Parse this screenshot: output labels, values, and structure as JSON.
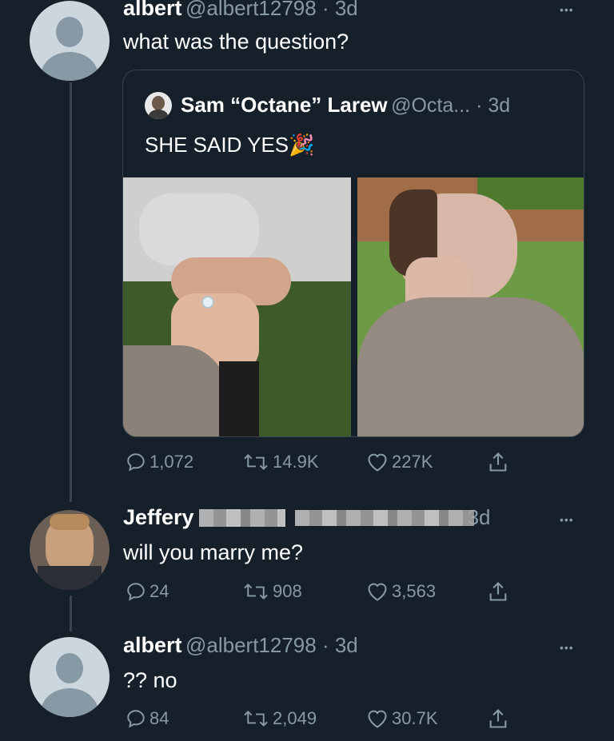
{
  "tweet1": {
    "name": "albert",
    "handle_time": "@albert12798 · 3d",
    "text": "what was the question?",
    "more": "•••",
    "quote": {
      "name": "Sam “Octane” Larew",
      "handle_time": "@Octa... · 3d",
      "text": "SHE SAID YES",
      "emoji": "🎉"
    },
    "actions": {
      "replies": "1,072",
      "retweets": "14.9K",
      "likes": "227K"
    }
  },
  "tweet2": {
    "name": "Jeffery",
    "time": "3d",
    "text": "will you marry me?",
    "more": "•••",
    "actions": {
      "replies": "24",
      "retweets": "908",
      "likes": "3,563"
    }
  },
  "tweet3": {
    "name": "albert",
    "handle_time": "@albert12798 · 3d",
    "text": "?? no",
    "more": "•••",
    "actions": {
      "replies": "84",
      "retweets": "2,049",
      "likes": "30.7K"
    }
  },
  "icons": {
    "reply": "reply-icon",
    "retweet": "retweet-icon",
    "like": "heart-icon",
    "share": "share-icon",
    "more": "more-icon"
  },
  "colors": {
    "background": "#15202b",
    "secondary_text": "#8899a6",
    "border": "#38444d"
  }
}
